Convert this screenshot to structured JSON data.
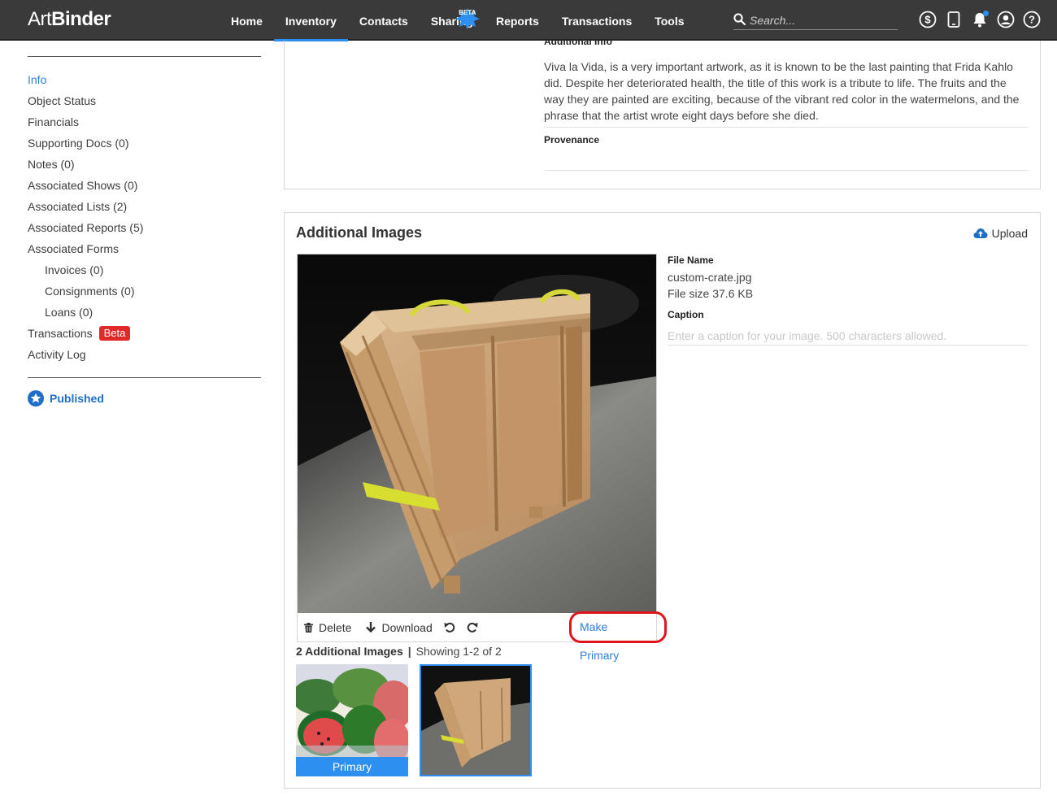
{
  "app": {
    "logo_part1": "Art",
    "logo_part2": "Binder"
  },
  "nav": {
    "items": [
      {
        "label": "Home"
      },
      {
        "label": "Inventory",
        "active": true
      },
      {
        "label": "Contacts"
      },
      {
        "label": "Sharing",
        "badge": "BETA"
      },
      {
        "label": "Reports"
      },
      {
        "label": "Transactions"
      },
      {
        "label": "Tools"
      }
    ],
    "search_placeholder": "Search..."
  },
  "sidebar": {
    "items": [
      {
        "label": "Info",
        "active": true
      },
      {
        "label": "Object Status"
      },
      {
        "label": "Financials"
      },
      {
        "label": "Supporting Docs (0)"
      },
      {
        "label": "Notes (0)"
      },
      {
        "label": "Associated Shows (0)"
      },
      {
        "label": "Associated Lists (2)"
      },
      {
        "label": "Associated Reports (5)"
      },
      {
        "label": "Associated Forms"
      },
      {
        "label": "Invoices (0)",
        "sub": true
      },
      {
        "label": "Consignments (0)",
        "sub": true
      },
      {
        "label": "Loans (0)",
        "sub": true
      },
      {
        "label": "Transactions",
        "badge": "Beta"
      },
      {
        "label": "Activity Log"
      }
    ],
    "published_label": "Published"
  },
  "info_panel": {
    "heading": "Additional Info",
    "text": "Viva la Vida, is a very important artwork, as it is known to be the last painting that Frida Kahlo did. Despite her deteriorated health, the title of this work is a tribute to life. The fruits and the way they are painted are exciting, because of the vibrant red color in the watermelons, and the phrase that the artist wrote eight days before she died.",
    "provenance_label": "Provenance"
  },
  "images_panel": {
    "title": "Additional Images",
    "upload_label": "Upload",
    "toolbar": {
      "delete_label": "Delete",
      "download_label": "Download",
      "make_primary_label": "Make Primary"
    },
    "file_name_label": "File Name",
    "file_name": "custom-crate.jpg",
    "file_size": "File size 37.6 KB",
    "caption_label": "Caption",
    "caption_placeholder": "Enter a caption for your image. 500 characters allowed.",
    "count_bold": "2 Additional Images",
    "count_sep": "|",
    "count_text": "Showing 1-2 of 2",
    "thumb_primary_label": "Primary"
  },
  "colors": {
    "accent": "#2d8ff0",
    "link": "#2d7fe0",
    "topbar": "#3a3a3a",
    "badge_red": "#e02a2a",
    "highlight": "#e0141c"
  }
}
